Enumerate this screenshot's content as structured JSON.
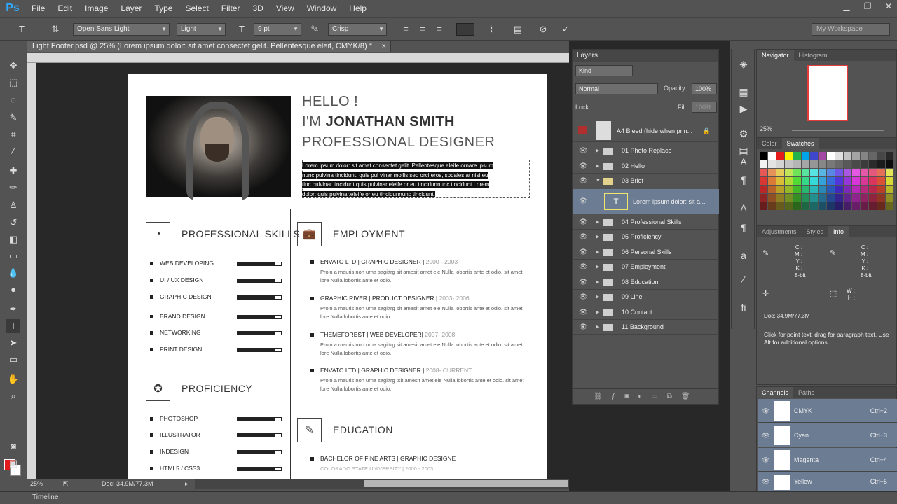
{
  "app": {
    "logo": "Ps"
  },
  "menu": [
    "File",
    "Edit",
    "Image",
    "Layer",
    "Type",
    "Select",
    "Filter",
    "3D",
    "View",
    "Window",
    "Help"
  ],
  "options": {
    "font_family": "Open Sans Light",
    "font_style": "Light",
    "font_size": "9 pt",
    "aa_label": "ªa",
    "antialias": "Crisp",
    "workspace": "My Workspace"
  },
  "document": {
    "tab": "Light Footer.psd @ 25% (Lorem ipsum dolor: sit amet consectet gelit. Pellentesque eleif, CMYK/8) *",
    "zoom": "25%",
    "doc_size": "Doc: 34.9M/77.3M"
  },
  "resume": {
    "hello": "HELLO !",
    "im": "I'M ",
    "name": "JONATHAN SMITH",
    "role": "PROFESSIONAL DESIGNER",
    "brief": [
      "Lorem ipsum dolor: sit amet consectet gelit. Pellentesque eleife ornare ipsum",
      "nunc pulvina tincidunt. quis pul vinar mollis sed orci eros, sodales at nisi.eu",
      "tinc pulvinar tincidunt quis pulvinar.eleife or eu tincidunnunc tincidunt.Lorem",
      "dolor: quis pulvinar.eleife or eu tincidunnunc tincidunt."
    ],
    "skills_title": "PROFESSIONAL SKILLS",
    "skills": [
      {
        "name": "WEB DEVELOPING",
        "level": 0.85
      },
      {
        "name": "UI / UX DESIGN",
        "level": 0.85
      },
      {
        "name": "GRAPHIC DESIGN",
        "level": 0.85
      },
      {
        "name": "BRAND DESIGN",
        "level": 0.85
      },
      {
        "name": "NETWORKING",
        "level": 0.85
      },
      {
        "name": "PRINT DESIGN",
        "level": 0.85
      }
    ],
    "proficiency_title": "PROFICIENCY",
    "proficiency": [
      {
        "name": "PHOTOSHOP",
        "level": 0.85
      },
      {
        "name": "ILLUSTRATOR",
        "level": 0.85
      },
      {
        "name": "INDESIGN",
        "level": 0.85
      },
      {
        "name": "HTML5 / CSS3",
        "level": 0.85
      }
    ],
    "employment_title": "EMPLOYMENT",
    "jobs": [
      {
        "title": "ENVATO LTD | GRAPHIC DESIGNER | ",
        "years": "2000 - 2003",
        "desc": "Proin a mauris non urna sagittrg sit amesit amet ele Nulla lobortis ante et odio. sit amet lore Nulla lobortis ante et odio."
      },
      {
        "title": "GRAPHIC RIVER | PRODUCT DESIGNER | ",
        "years": "2003- 2006",
        "desc": "Proin a mauris non urna sagittrg sit amesit amet ele Nulla lobortis ante et odio. sit amet lore Nulla lobortis ante et odio."
      },
      {
        "title": "THEMEFOREST | WEB DEVELOPER| ",
        "years": "2007- 2008",
        "desc": "Proin a mauris non urna sagittrg sit amesit amet ele Nulla lobortis ante et odio. sit amet lore Nulla lobortis ante et odio."
      },
      {
        "title": "ENVATO LTD | GRAPHIC DESIGNER | ",
        "years": "2008- CURRENT",
        "desc": "Proin a mauris non urna sagittrg tsit amesit amet ele Nulla lobortis ante et odio. sit amet lore Nulla lobortis ante et odio."
      }
    ],
    "education_title": "EDUCATION",
    "edu": {
      "title": "BACHELOR OF FINE ARTS | GRAPHIC DESIGNE",
      "years": "COLORADO STATE UNIVERSITY | 2000 - 2003"
    }
  },
  "layers_panel": {
    "title": "Layers",
    "kind": "Kind",
    "blend": "Normal",
    "opacity_label": "Opacity:",
    "opacity": "100%",
    "lock_label": "Lock:",
    "fill_label": "Fill:",
    "fill": "100%",
    "top_layer": "A4 Bleed (hide when prin...",
    "selected_layer": "Lorem ipsum dolor: sit a...",
    "groups": [
      "01  Photo Replace",
      "02  Hello",
      "03  Brief",
      "04  Professional Skills",
      "05   Proficiency",
      "06  Personal Skills",
      "07  Employment",
      "08  Education",
      "09  Line",
      "10  Contact",
      "11  Background"
    ]
  },
  "nav_panel": {
    "tabs": [
      "Navigator",
      "Histogram"
    ],
    "zoom": "25%"
  },
  "swatch_panel": {
    "tabs": [
      "Color",
      "Swatches"
    ]
  },
  "info_panel": {
    "tabs": [
      "Adjustments",
      "Styles",
      "Info"
    ],
    "cmyk_labels": "C :\nM :\nY :\nK :",
    "bit1": "8-bit",
    "bit2": "8-bit",
    "wh": "W :\nH :",
    "doc": "Doc: 34.9M/77.3M",
    "hint": "Click for point text, drag for paragraph text. Use Alt for additional options."
  },
  "channels_panel": {
    "tabs": [
      "Channels",
      "Paths"
    ],
    "rows": [
      {
        "name": "CMYK",
        "shortcut": "Ctrl+2"
      },
      {
        "name": "Cyan",
        "shortcut": "Ctrl+3"
      },
      {
        "name": "Magenta",
        "shortcut": "Ctrl+4"
      },
      {
        "name": "Yellow",
        "shortcut": "Ctrl+5"
      }
    ]
  },
  "timeline": "Timeline",
  "colors": {
    "foreground": "#e01b1b",
    "background": "#ffffff",
    "selection": "#6b7c93"
  }
}
